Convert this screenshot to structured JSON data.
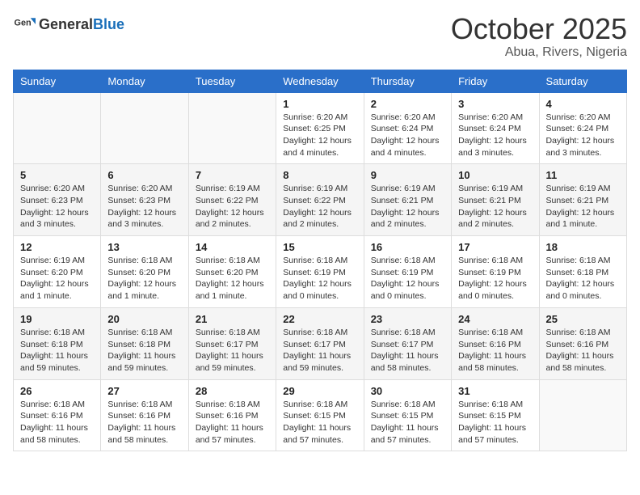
{
  "logo": {
    "text_general": "General",
    "text_blue": "Blue"
  },
  "header": {
    "month": "October 2025",
    "location": "Abua, Rivers, Nigeria"
  },
  "weekdays": [
    "Sunday",
    "Monday",
    "Tuesday",
    "Wednesday",
    "Thursday",
    "Friday",
    "Saturday"
  ],
  "weeks": [
    [
      {
        "day": "",
        "info": ""
      },
      {
        "day": "",
        "info": ""
      },
      {
        "day": "",
        "info": ""
      },
      {
        "day": "1",
        "info": "Sunrise: 6:20 AM\nSunset: 6:25 PM\nDaylight: 12 hours\nand 4 minutes."
      },
      {
        "day": "2",
        "info": "Sunrise: 6:20 AM\nSunset: 6:24 PM\nDaylight: 12 hours\nand 4 minutes."
      },
      {
        "day": "3",
        "info": "Sunrise: 6:20 AM\nSunset: 6:24 PM\nDaylight: 12 hours\nand 3 minutes."
      },
      {
        "day": "4",
        "info": "Sunrise: 6:20 AM\nSunset: 6:24 PM\nDaylight: 12 hours\nand 3 minutes."
      }
    ],
    [
      {
        "day": "5",
        "info": "Sunrise: 6:20 AM\nSunset: 6:23 PM\nDaylight: 12 hours\nand 3 minutes."
      },
      {
        "day": "6",
        "info": "Sunrise: 6:20 AM\nSunset: 6:23 PM\nDaylight: 12 hours\nand 3 minutes."
      },
      {
        "day": "7",
        "info": "Sunrise: 6:19 AM\nSunset: 6:22 PM\nDaylight: 12 hours\nand 2 minutes."
      },
      {
        "day": "8",
        "info": "Sunrise: 6:19 AM\nSunset: 6:22 PM\nDaylight: 12 hours\nand 2 minutes."
      },
      {
        "day": "9",
        "info": "Sunrise: 6:19 AM\nSunset: 6:21 PM\nDaylight: 12 hours\nand 2 minutes."
      },
      {
        "day": "10",
        "info": "Sunrise: 6:19 AM\nSunset: 6:21 PM\nDaylight: 12 hours\nand 2 minutes."
      },
      {
        "day": "11",
        "info": "Sunrise: 6:19 AM\nSunset: 6:21 PM\nDaylight: 12 hours\nand 1 minute."
      }
    ],
    [
      {
        "day": "12",
        "info": "Sunrise: 6:19 AM\nSunset: 6:20 PM\nDaylight: 12 hours\nand 1 minute."
      },
      {
        "day": "13",
        "info": "Sunrise: 6:18 AM\nSunset: 6:20 PM\nDaylight: 12 hours\nand 1 minute."
      },
      {
        "day": "14",
        "info": "Sunrise: 6:18 AM\nSunset: 6:20 PM\nDaylight: 12 hours\nand 1 minute."
      },
      {
        "day": "15",
        "info": "Sunrise: 6:18 AM\nSunset: 6:19 PM\nDaylight: 12 hours\nand 0 minutes."
      },
      {
        "day": "16",
        "info": "Sunrise: 6:18 AM\nSunset: 6:19 PM\nDaylight: 12 hours\nand 0 minutes."
      },
      {
        "day": "17",
        "info": "Sunrise: 6:18 AM\nSunset: 6:19 PM\nDaylight: 12 hours\nand 0 minutes."
      },
      {
        "day": "18",
        "info": "Sunrise: 6:18 AM\nSunset: 6:18 PM\nDaylight: 12 hours\nand 0 minutes."
      }
    ],
    [
      {
        "day": "19",
        "info": "Sunrise: 6:18 AM\nSunset: 6:18 PM\nDaylight: 11 hours\nand 59 minutes."
      },
      {
        "day": "20",
        "info": "Sunrise: 6:18 AM\nSunset: 6:18 PM\nDaylight: 11 hours\nand 59 minutes."
      },
      {
        "day": "21",
        "info": "Sunrise: 6:18 AM\nSunset: 6:17 PM\nDaylight: 11 hours\nand 59 minutes."
      },
      {
        "day": "22",
        "info": "Sunrise: 6:18 AM\nSunset: 6:17 PM\nDaylight: 11 hours\nand 59 minutes."
      },
      {
        "day": "23",
        "info": "Sunrise: 6:18 AM\nSunset: 6:17 PM\nDaylight: 11 hours\nand 58 minutes."
      },
      {
        "day": "24",
        "info": "Sunrise: 6:18 AM\nSunset: 6:16 PM\nDaylight: 11 hours\nand 58 minutes."
      },
      {
        "day": "25",
        "info": "Sunrise: 6:18 AM\nSunset: 6:16 PM\nDaylight: 11 hours\nand 58 minutes."
      }
    ],
    [
      {
        "day": "26",
        "info": "Sunrise: 6:18 AM\nSunset: 6:16 PM\nDaylight: 11 hours\nand 58 minutes."
      },
      {
        "day": "27",
        "info": "Sunrise: 6:18 AM\nSunset: 6:16 PM\nDaylight: 11 hours\nand 58 minutes."
      },
      {
        "day": "28",
        "info": "Sunrise: 6:18 AM\nSunset: 6:16 PM\nDaylight: 11 hours\nand 57 minutes."
      },
      {
        "day": "29",
        "info": "Sunrise: 6:18 AM\nSunset: 6:15 PM\nDaylight: 11 hours\nand 57 minutes."
      },
      {
        "day": "30",
        "info": "Sunrise: 6:18 AM\nSunset: 6:15 PM\nDaylight: 11 hours\nand 57 minutes."
      },
      {
        "day": "31",
        "info": "Sunrise: 6:18 AM\nSunset: 6:15 PM\nDaylight: 11 hours\nand 57 minutes."
      },
      {
        "day": "",
        "info": ""
      }
    ]
  ]
}
